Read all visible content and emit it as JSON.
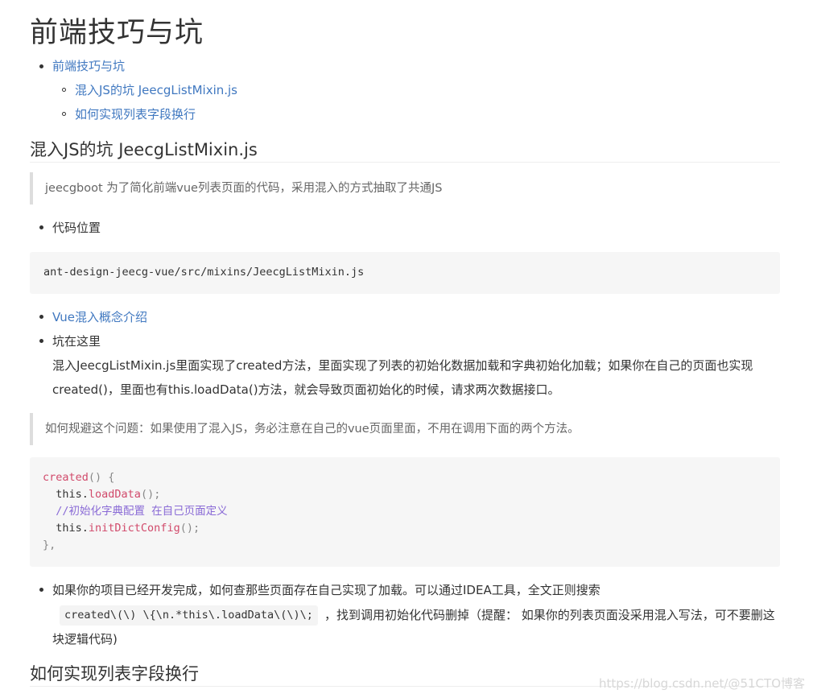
{
  "title": "前端技巧与坑",
  "toc": {
    "item1": "前端技巧与坑",
    "sub1": "混入JS的坑 JeecgListMixin.js",
    "sub2": "如何实现列表字段换行"
  },
  "section1": {
    "heading": "混入JS的坑 JeecgListMixin.js",
    "quote1": "jeecgboot 为了简化前端vue列表页面的代码，采用混入的方式抽取了共通JS",
    "bullet_location": "代码位置",
    "code_path": "ant-design-jeecg-vue/src/mixins/JeecgListMixin.js",
    "bullet_link": "Vue混入概念介绍",
    "bullet_pit": "坑在这里",
    "pit_para_line1": "混入JeecgListMixin.js里面实现了created方法，里面实现了列表的初始化数据加载和字典初始化加载；如果你在自己的页面也实现",
    "pit_para_line2": "created()，里面也有this.loadData()方法，就会导致页面初始化的时候，请求两次数据接口。",
    "quote2": "如何规避这个问题：如果使用了混入JS，务必注意在自己的vue页面里面，不用在调用下面的两个方法。",
    "code2": {
      "l1_fn": "created",
      "l1_rest": "() {",
      "l2_obj": "  this.",
      "l2_fn": "loadData",
      "l2_rest": "();",
      "l3_comment": "  //初始化字典配置 在自己页面定义",
      "l4_obj": "  this.",
      "l4_fn": "initDictConfig",
      "l4_rest": "();",
      "l5": "},"
    },
    "bullet_search_line1": "如果你的项目已经开发完成，如何查那些页面存在自己实现了加载。可以通过IDEA工具，全文正则搜索",
    "inline_regex": "created\\(\\) \\{\\n.*this\\.loadData\\(\\)\\;",
    "bullet_search_line2_rest": "，找到调用初始化代码删掉（提醒： 如果你的列表页面没采用混入写法，可不要删这",
    "bullet_search_line3": "块逻辑代码)"
  },
  "section2": {
    "heading": "如何实现列表字段换行"
  },
  "watermark": "https://blog.csdn.net/@51CTO博客"
}
